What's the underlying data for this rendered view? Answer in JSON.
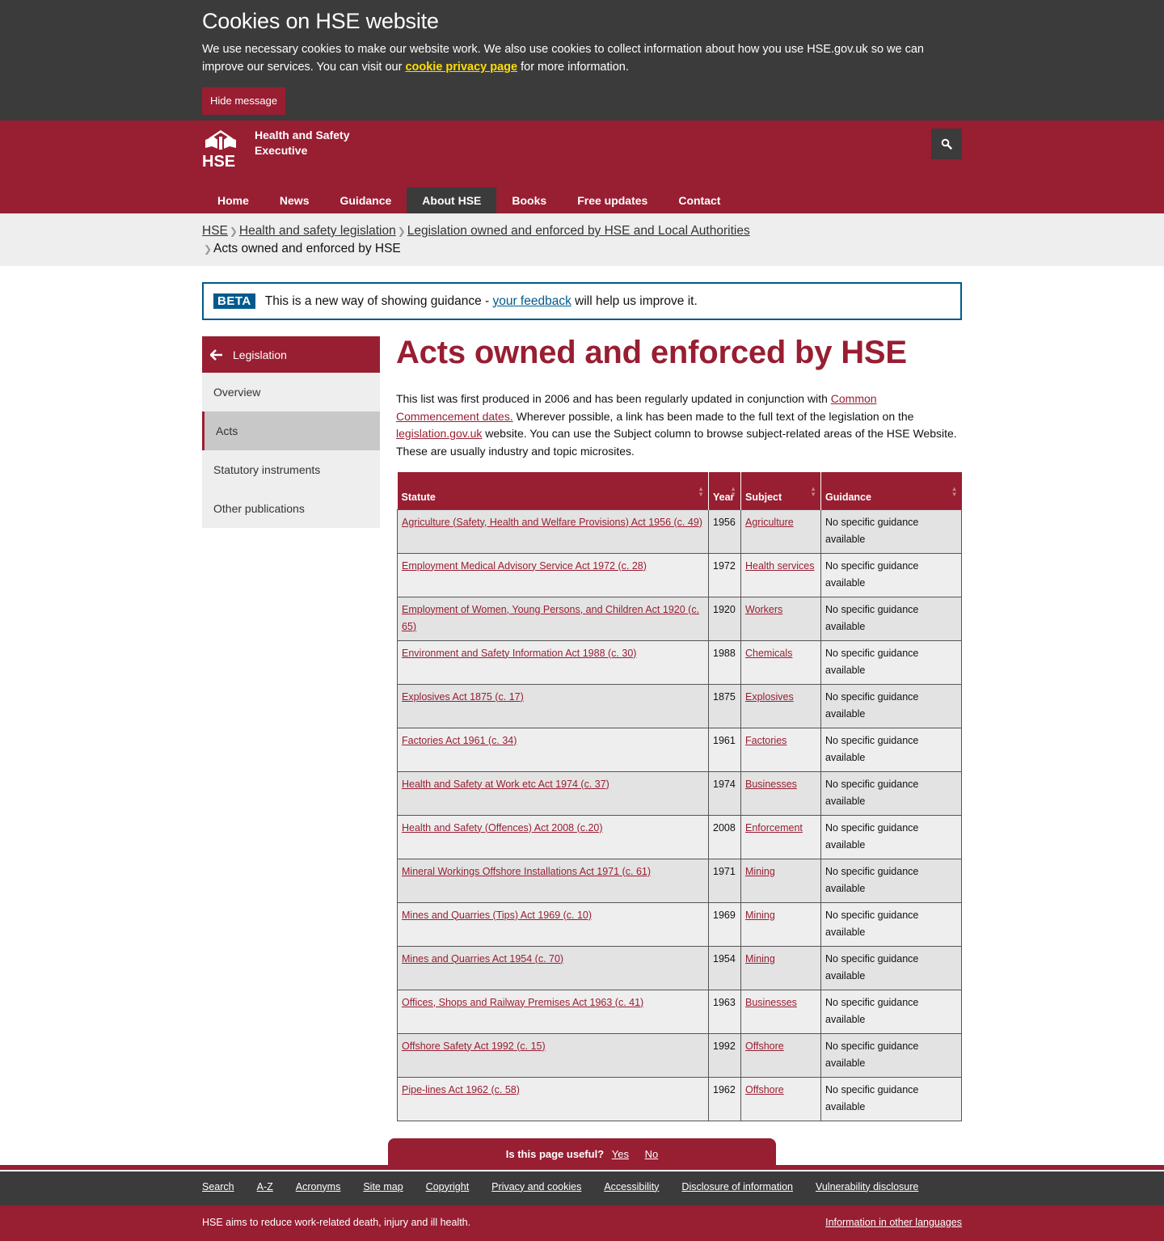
{
  "cookie": {
    "title": "Cookies on HSE website",
    "text_before": "We use necessary cookies to make our website work. We also use cookies to collect information about how you use HSE.gov.uk so we can improve our services. You can visit our ",
    "link": "cookie privacy page",
    "text_after": " for more information.",
    "hide_button": "Hide message"
  },
  "header": {
    "logo_text": "HSE",
    "org_name": "Health and Safety Executive",
    "search_icon": "search-icon"
  },
  "nav": {
    "items": [
      "Home",
      "News",
      "Guidance",
      "About HSE",
      "Books",
      "Free updates",
      "Contact"
    ],
    "active": "About HSE"
  },
  "breadcrumb": {
    "items": [
      "HSE",
      "Health and safety legislation",
      "Legislation owned and enforced by HSE and Local Authorities"
    ],
    "current": "Acts owned and enforced by HSE"
  },
  "beta": {
    "tag": "BETA",
    "text_before": "This is a new way of showing guidance - ",
    "link": "your feedback",
    "text_after": " will help us improve it."
  },
  "sidebar": {
    "back_label": "Legislation",
    "items": [
      "Overview",
      "Acts",
      "Statutory instruments",
      "Other publications"
    ],
    "active": "Acts"
  },
  "page": {
    "title": "Acts owned and enforced by HSE",
    "intro_1": "This list was first produced in 2006 and has been regularly updated in conjunction with ",
    "intro_link_1": "Common Commencement dates.",
    "intro_2": " Wherever possible, a link has been made to the full text of the legislation on the ",
    "intro_link_2": "legislation.gov.uk",
    "intro_3": " website. You can use the Subject column to browse subject-related areas of the HSE Website. These are usually industry and topic microsites."
  },
  "table": {
    "headers": [
      "Statute",
      "Year",
      "Subject",
      "Guidance"
    ],
    "rows": [
      {
        "statute": "Agriculture (Safety, Health and Welfare Provisions) Act 1956 (c. 49)",
        "year": "1956",
        "subject": "Agriculture",
        "guidance": "No specific guidance available"
      },
      {
        "statute": "Employment Medical Advisory Service Act 1972 (c. 28)",
        "year": "1972",
        "subject": "Health services",
        "guidance": "No specific guidance available"
      },
      {
        "statute": "Employment of Women, Young Persons, and Children Act 1920 (c. 65)",
        "year": "1920",
        "subject": "Workers",
        "guidance": "No specific guidance available"
      },
      {
        "statute": "Environment and Safety Information Act 1988 (c. 30)",
        "year": "1988",
        "subject": "Chemicals",
        "guidance": "No specific guidance available"
      },
      {
        "statute": "Explosives Act 1875 (c. 17)",
        "year": "1875",
        "subject": "Explosives",
        "guidance": "No specific guidance available"
      },
      {
        "statute": "Factories Act 1961 (c. 34)",
        "year": "1961",
        "subject": "Factories",
        "guidance": "No specific guidance available"
      },
      {
        "statute": "Health and Safety at Work etc Act 1974 (c. 37)",
        "year": "1974",
        "subject": "Businesses",
        "guidance": "No specific guidance available"
      },
      {
        "statute": "Health and Safety (Offences) Act 2008 (c.20)",
        "year": "2008",
        "subject": "Enforcement",
        "guidance": "No specific guidance available"
      },
      {
        "statute": "Mineral Workings Offshore Installations Act 1971 (c. 61)",
        "year": "1971",
        "subject": "Mining",
        "guidance": "No specific guidance available"
      },
      {
        "statute": "Mines and Quarries (Tips) Act 1969 (c. 10)",
        "year": "1969",
        "subject": "Mining",
        "guidance": "No specific guidance available"
      },
      {
        "statute": "Mines and Quarries Act 1954 (c. 70)",
        "year": "1954",
        "subject": "Mining",
        "guidance": "No specific guidance available"
      },
      {
        "statute": "Offices, Shops and Railway Premises Act 1963 (c. 41)",
        "year": "1963",
        "subject": "Businesses",
        "guidance": "No specific guidance available"
      },
      {
        "statute": "Offshore Safety Act 1992 (c. 15)",
        "year": "1992",
        "subject": "Offshore",
        "guidance": "No specific guidance available"
      },
      {
        "statute": "Pipe-lines Act 1962 (c. 58)",
        "year": "1962",
        "subject": "Offshore",
        "guidance": "No specific guidance available"
      }
    ]
  },
  "useful": {
    "question": "Is this page useful?",
    "yes": "Yes",
    "no": "No"
  },
  "footer": {
    "links": [
      "Search",
      "A-Z",
      "Acronyms",
      "Site map",
      "Copyright",
      "Privacy and cookies",
      "Accessibility",
      "Disclosure of information",
      "Vulnerability disclosure"
    ],
    "tagline": "HSE aims to reduce work-related death, injury and ill health.",
    "languages_link": "Information in other languages"
  },
  "colors": {
    "brand": "#981e32",
    "dark": "#3b3b3b",
    "beta": "#005a8c",
    "cookie_link": "#ffdd00"
  }
}
